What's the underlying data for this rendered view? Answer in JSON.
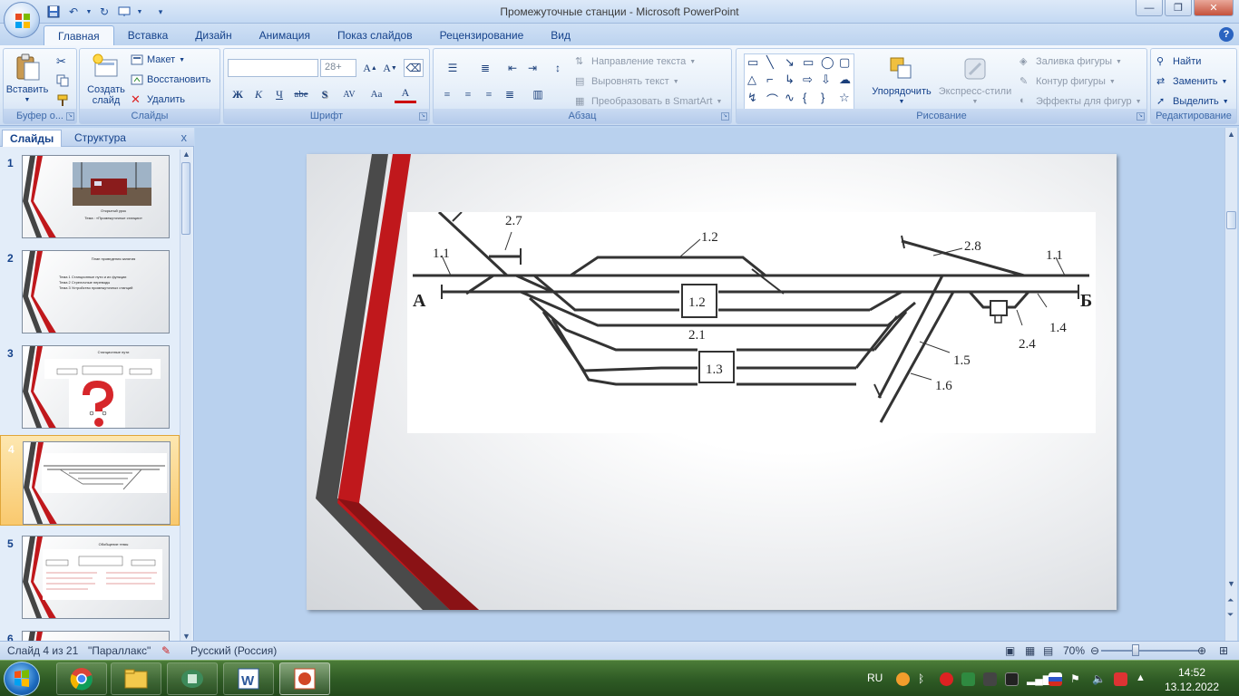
{
  "window": {
    "title": "Промежуточные станции - Microsoft PowerPoint"
  },
  "ribbon": {
    "tabs": [
      "Главная",
      "Вставка",
      "Дизайн",
      "Анимация",
      "Показ слайдов",
      "Рецензирование",
      "Вид"
    ],
    "active_tab": "Главная",
    "clipboard": {
      "label": "Буфер о...",
      "paste": "Вставить"
    },
    "slides": {
      "label": "Слайды",
      "new_slide_line1": "Создать",
      "new_slide_line2": "слайд",
      "layout": "Макет",
      "reset": "Восстановить",
      "delete": "Удалить"
    },
    "font": {
      "label": "Шрифт",
      "font_name": "",
      "font_size": "28+",
      "bold": "Ж",
      "italic": "К",
      "underline": "Ч",
      "strike": "abe",
      "shadow": "S",
      "spacing": "AV",
      "case": "Aa",
      "color": "A"
    },
    "paragraph": {
      "label": "Абзац",
      "text_direction": "Направление текста",
      "align_text": "Выровнять текст",
      "smartart": "Преобразовать в SmartArt"
    },
    "drawing": {
      "label": "Рисование",
      "arrange": "Упорядочить",
      "quick_styles": "Экспресс-стили",
      "fill": "Заливка фигуры",
      "outline": "Контур фигуры",
      "effects": "Эффекты для фигур"
    },
    "editing": {
      "label": "Редактирование",
      "find": "Найти",
      "replace": "Заменить",
      "select": "Выделить"
    }
  },
  "left_pane": {
    "tab_slides": "Слайды",
    "tab_outline": "Структура",
    "close": "x",
    "thumbnails": [
      {
        "num": "1",
        "lines": [
          "Открытый урок",
          "Тема : «Промежуточные станции»"
        ]
      },
      {
        "num": "2",
        "lines": [
          "План проведения занятия",
          "Тема 1 Станционные пути и их функции",
          "Тема 2 Стрелочные переводы",
          "Тема 3 Устройство промежуточных станций"
        ]
      },
      {
        "num": "3",
        "lines": [
          "Станционные пути"
        ]
      },
      {
        "num": "4",
        "lines": []
      },
      {
        "num": "5",
        "lines": [
          "Обобщение темы"
        ]
      },
      {
        "num": "6",
        "lines": []
      }
    ],
    "selected": "4"
  },
  "slide_diagram": {
    "labels": {
      "a": "А",
      "b": "Б",
      "l11_left": "1.1",
      "l11_right": "1.1",
      "l27": "2.7",
      "l12_top": "1.2",
      "l12_box": "1.2",
      "l28": "2.8",
      "l14": "1.4",
      "l24": "2.4",
      "l21": "2.1",
      "l13_box": "1.3",
      "l15": "1.5",
      "l16": "1.6"
    }
  },
  "status": {
    "slide_counter": "Слайд 4 из 21",
    "theme": "\"Параллакс\"",
    "language": "Русский (Россия)",
    "zoom": "70%"
  },
  "taskbar": {
    "lang": "RU",
    "time": "14:52",
    "date": "13.12.2022"
  },
  "colors": {
    "accent_red": "#c0181c",
    "stripe_gray": "#4a4a4a",
    "selected_thumb": "#f9c96e"
  }
}
